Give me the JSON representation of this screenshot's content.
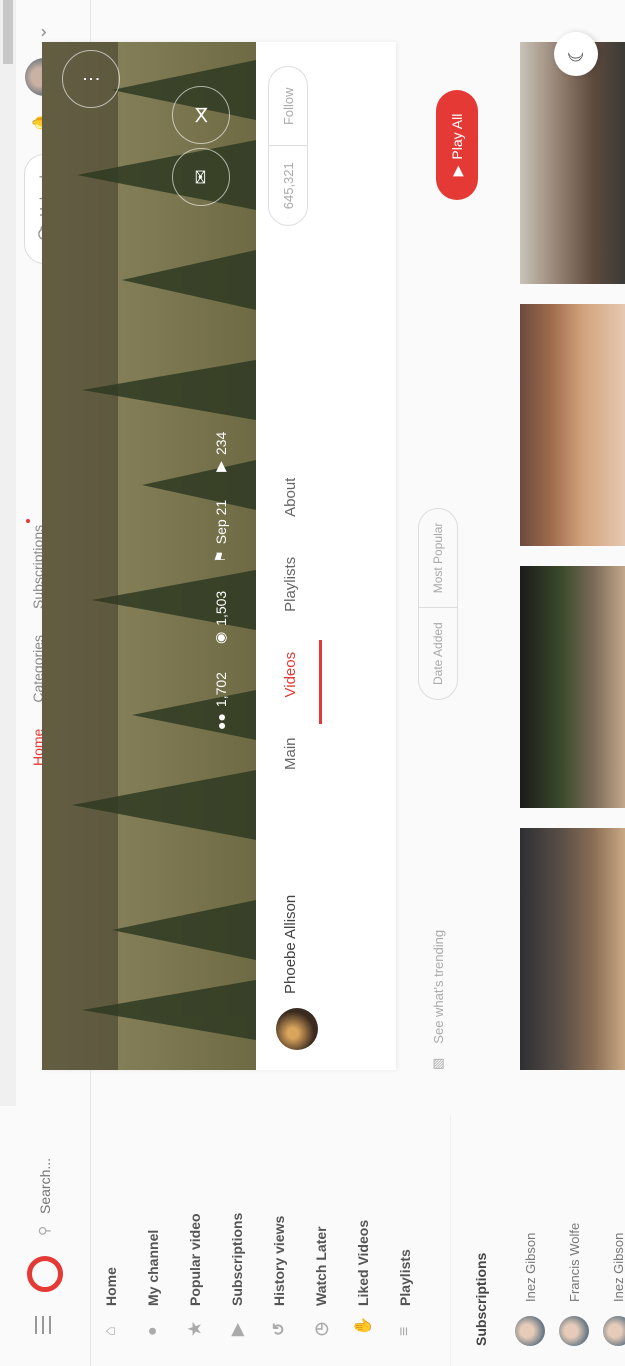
{
  "topbar": {
    "search_placeholder": "Search...",
    "nav": [
      {
        "label": "Home",
        "active": true
      },
      {
        "label": "Categories",
        "active": false
      },
      {
        "label": "Subscriptions",
        "active": false,
        "has_dot": true
      }
    ],
    "upload_label": "Upload"
  },
  "sidebar": {
    "items": [
      {
        "label": "Home",
        "icon": "home-icon"
      },
      {
        "label": "My channel",
        "icon": "user-icon"
      },
      {
        "label": "Popular video",
        "icon": "star-icon"
      },
      {
        "label": "Subscriptions",
        "icon": "play-square-icon"
      },
      {
        "label": "History views",
        "icon": "history-icon"
      },
      {
        "label": "Watch Later",
        "icon": "clock-icon"
      },
      {
        "label": "Liked Videos",
        "icon": "thumbs-up-icon"
      },
      {
        "label": "Playlists",
        "icon": "playlist-icon"
      }
    ],
    "subscriptions_title": "Subscriptions",
    "subscriptions": [
      {
        "name": "Inez Gibson"
      },
      {
        "name": "Francis Wolfe"
      },
      {
        "name": "Inez Gibson"
      }
    ]
  },
  "channel": {
    "stats": {
      "subscribers": "1,702",
      "views": "1,503",
      "date": "Sep 21",
      "videos": "234"
    },
    "name": "Phoebe Allison",
    "tabs": [
      {
        "label": "Main",
        "active": false
      },
      {
        "label": "Videos",
        "active": true
      },
      {
        "label": "Playlists",
        "active": false
      },
      {
        "label": "About",
        "active": false
      }
    ],
    "followers": "645,321",
    "follow_label": "Follow"
  },
  "controls": {
    "trending_label": "See what's trending",
    "sort_options": [
      "Date Added",
      "Most Popular"
    ],
    "play_all_label": "Play All"
  },
  "colors": {
    "accent": "#e53935"
  }
}
